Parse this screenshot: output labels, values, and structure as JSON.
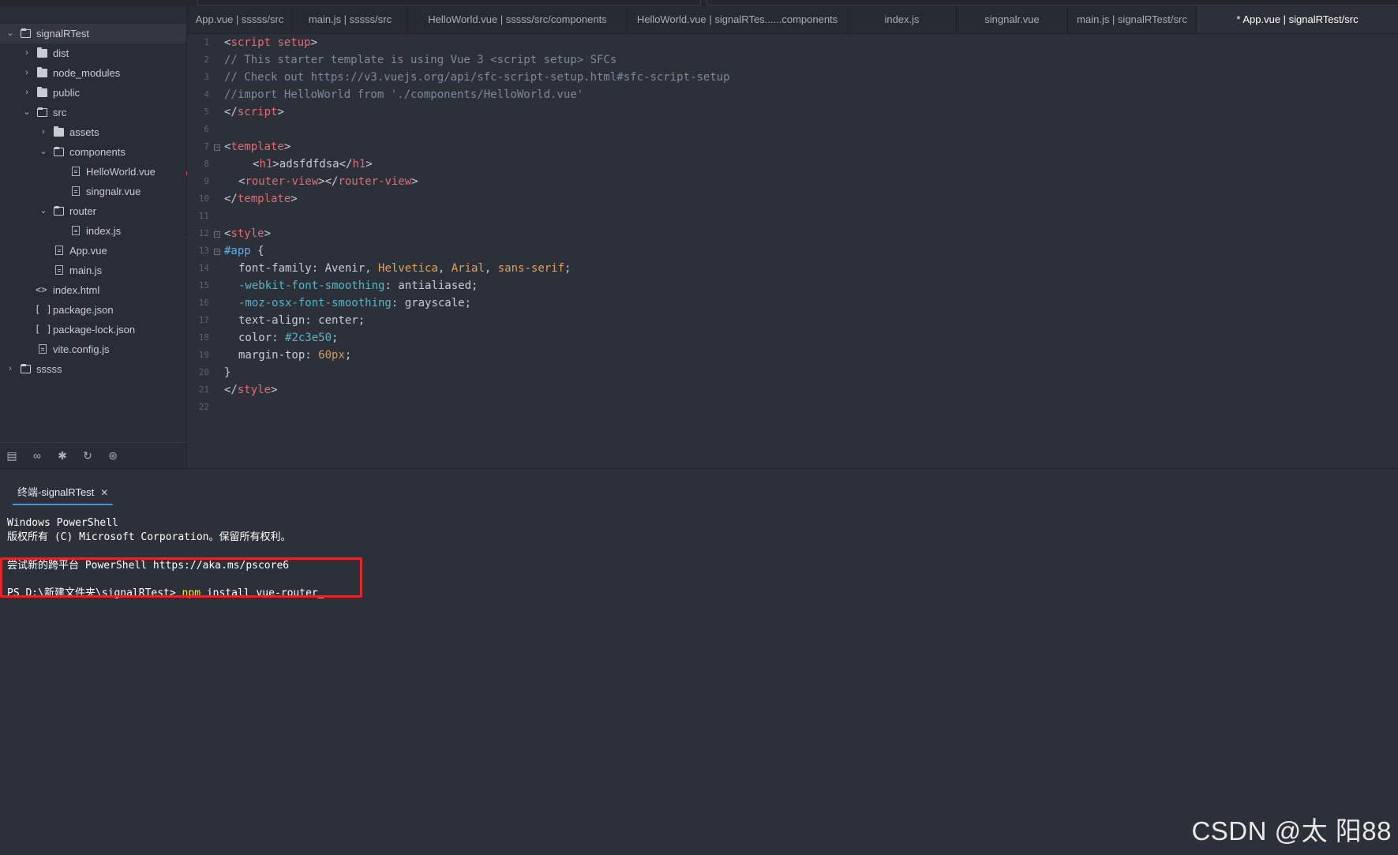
{
  "tabs": [
    {
      "label": "App.vue | sssss/src",
      "active": false
    },
    {
      "label": "main.js | sssss/src",
      "active": false
    },
    {
      "label": "HelloWorld.vue | sssss/src/components",
      "active": false
    },
    {
      "label": "HelloWorld.vue | signalRTes......components",
      "active": false
    },
    {
      "label": "index.js",
      "active": false
    },
    {
      "label": "singnalr.vue",
      "active": false
    },
    {
      "label": "main.js | signalRTest/src",
      "active": false
    },
    {
      "label": "* App.vue | signalRTest/src",
      "active": true
    }
  ],
  "tree": {
    "root": "signalRTest",
    "dist": "dist",
    "node_modules": "node_modules",
    "public": "public",
    "src": "src",
    "assets": "assets",
    "components": "components",
    "helloworld": "HelloWorld.vue",
    "singnalr": "singnalr.vue",
    "router": "router",
    "indexjs": "index.js",
    "appvue": "App.vue",
    "mainjs": "main.js",
    "indexhtml": "index.html",
    "packagejson": "package.json",
    "packagelock": "package-lock.json",
    "viteconfig": "vite.config.js",
    "sssss": "sssss"
  },
  "tree_icons": {
    "html": "<>",
    "json": "[ ]"
  },
  "line_numbers": [
    "1",
    "2",
    "3",
    "4",
    "5",
    "6",
    "7",
    "8",
    "9",
    "10",
    "11",
    "12",
    "13",
    "14",
    "15",
    "16",
    "17",
    "18",
    "19",
    "20",
    "21",
    "22"
  ],
  "code": {
    "l1": {
      "a": "<",
      "b": "script setup",
      "c": ">"
    },
    "l2": "// This starter template is using Vue 3 <script setup> SFCs",
    "l3": "// Check out https://v3.vuejs.org/api/sfc-script-setup.html#sfc-script-setup",
    "l4": "//import HelloWorld from './components/HelloWorld.vue'",
    "l5": {
      "a": "</",
      "b": "script",
      "c": ">"
    },
    "l7": {
      "a": "<",
      "b": "template",
      "c": ">"
    },
    "l8": {
      "a": "<",
      "b": "h1",
      "c": ">adsfdfdsa</",
      "d": "h1",
      "e": ">"
    },
    "l9": {
      "a": "<",
      "b": "router-view",
      "c": "></",
      "d": "router-view",
      "e": ">"
    },
    "l10": {
      "a": "</",
      "b": "template",
      "c": ">"
    },
    "l12": {
      "a": "<",
      "b": "style",
      "c": ">"
    },
    "l13": {
      "a": "#app",
      "b": " {"
    },
    "l14": {
      "a": "font-family: Avenir, ",
      "b": "Helvetica",
      "c": ", ",
      "d": "Arial",
      "e": ", ",
      "f": "sans-serif",
      "g": ";"
    },
    "l15": {
      "a": "-webkit-font-smoothing",
      "b": ": antialiased;"
    },
    "l16": {
      "a": "-moz-osx-font-smoothing",
      "b": ": grayscale;"
    },
    "l17": "text-align: center;",
    "l18": {
      "a": "color: ",
      "b": "#2c3e50",
      "c": ";"
    },
    "l19": {
      "a": "margin-top: ",
      "b": "60px",
      "c": ";"
    },
    "l20": "}",
    "l21": {
      "a": "</",
      "b": "style",
      "c": ">"
    }
  },
  "fold_marker": "−",
  "terminal": {
    "tab_label": "终端-signalRTest",
    "close": "✕",
    "line1": "Windows PowerShell",
    "line2": "版权所有 (C) Microsoft Corporation。保留所有权利。",
    "line3": "尝试新的跨平台 PowerShell https://aka.ms/pscore6",
    "prompt": "PS D:\\新建文件夹\\signalRTest> ",
    "cmd": "npm",
    "args": " install vue-router_"
  },
  "watermark": "CSDN @太 阳88",
  "colors": {
    "highlight_box": "#e0252b",
    "active_tab_underline": "#4a90d9",
    "npm_keyword": "#f2e24b"
  }
}
